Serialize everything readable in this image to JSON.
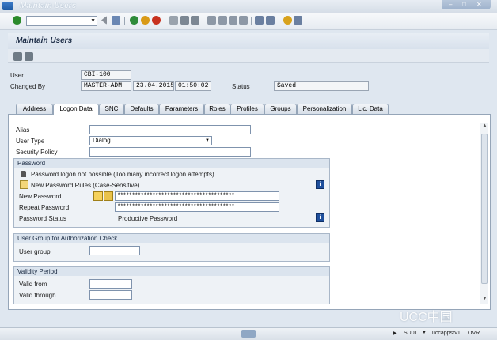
{
  "window": {
    "title": "Maintain Users",
    "command_field_value": ""
  },
  "header": {
    "title": "Maintain Users"
  },
  "user_info": {
    "user_label": "User",
    "user_value": "CBI-100",
    "changed_by_label": "Changed By",
    "changed_by_value": "MASTER-ADM",
    "date_value": "23.04.2015",
    "time_value": "01:50:02",
    "status_label": "Status",
    "status_value": "Saved"
  },
  "tabs": [
    {
      "label": "Address"
    },
    {
      "label": "Logon Data"
    },
    {
      "label": "SNC"
    },
    {
      "label": "Defaults"
    },
    {
      "label": "Parameters"
    },
    {
      "label": "Roles"
    },
    {
      "label": "Profiles"
    },
    {
      "label": "Groups"
    },
    {
      "label": "Personalization"
    },
    {
      "label": "Lic. Data"
    }
  ],
  "logon": {
    "alias_label": "Alias",
    "alias_value": "",
    "user_type_label": "User Type",
    "user_type_value": "Dialog",
    "security_policy_label": "Security Policy",
    "security_policy_value": ""
  },
  "password_group": {
    "title": "Password",
    "message": "Password logon not possible (Too many incorrect logon attempts)",
    "rules_label": "New Password Rules (Case-Sensitive)",
    "new_password_label": "New Password",
    "new_password_value": "****************************************",
    "repeat_password_label": "Repeat Password",
    "repeat_password_value": "****************************************",
    "status_label": "Password Status",
    "status_value": "Productive Password"
  },
  "auth_group": {
    "title": "User Group for Authorization Check",
    "user_group_label": "User group",
    "user_group_value": ""
  },
  "validity_group": {
    "title": "Validity Period",
    "valid_from_label": "Valid from",
    "valid_from_value": "",
    "valid_through_label": "Valid through",
    "valid_through_value": ""
  },
  "statusbar": {
    "transaction": "SU01",
    "server": "uccappsrv1",
    "mode": "OVR"
  },
  "watermark": "UCC中国",
  "colors": {
    "panel_bg": "#dfe7f0",
    "info_button": "#1e4f9c",
    "tab_border": "#95a5b8"
  },
  "icons": [
    "enter-icon",
    "back-icon",
    "save-icon",
    "exit-icon",
    "cancel-icon",
    "print-icon",
    "find-icon",
    "help-icon",
    "change-icon",
    "display-icon",
    "info-icon",
    "lock-icon"
  ]
}
